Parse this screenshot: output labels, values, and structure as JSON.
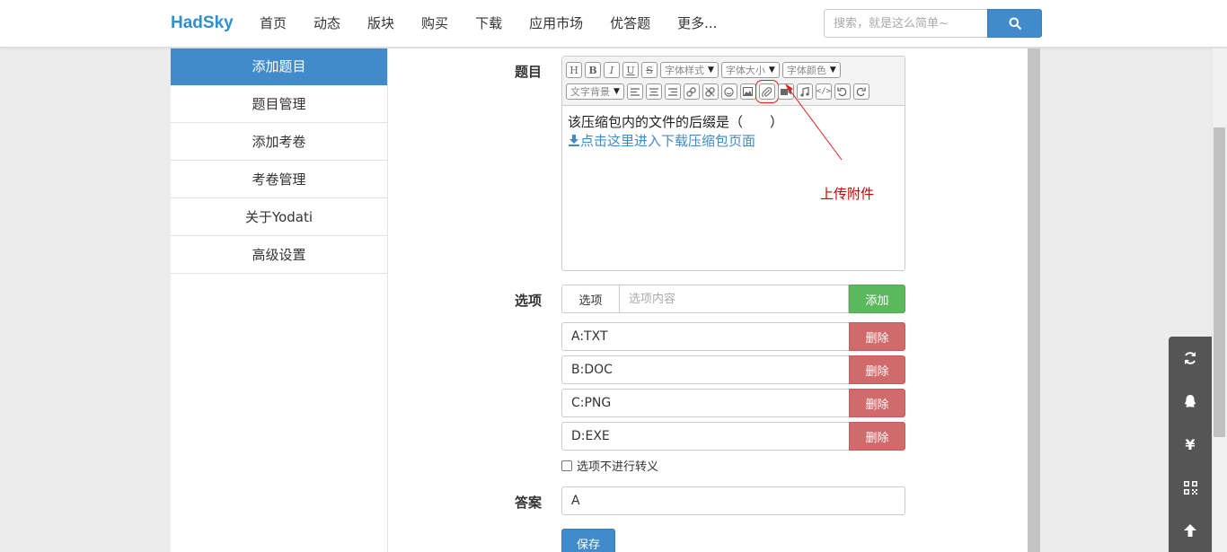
{
  "brand": "HadSky",
  "nav": [
    "首页",
    "动态",
    "版块",
    "购买",
    "下载",
    "应用市场",
    "优答题",
    "更多..."
  ],
  "search": {
    "placeholder": "搜索，就是这么简单~"
  },
  "sidebar": {
    "items": [
      {
        "label": "添加题目",
        "active": true
      },
      {
        "label": "题目管理"
      },
      {
        "label": "添加考卷"
      },
      {
        "label": "考卷管理"
      },
      {
        "label": "关于Yodati"
      },
      {
        "label": "高级设置"
      }
    ]
  },
  "form": {
    "question_label": "题目",
    "options_label": "选项",
    "answer_label": "答案",
    "toolbar": {
      "selects": [
        "字体样式",
        "字体大小",
        "字体颜色",
        "文字背景"
      ]
    },
    "question_text": "该压缩包内的文件的后缀是（　　）",
    "question_link": "点击这里进入下载压缩包页面",
    "annotation": "上传附件",
    "option_key": "选项",
    "option_value_placeholder": "选项内容",
    "add_label": "添加",
    "options": [
      "A:TXT",
      "B:DOC",
      "C:PNG",
      "D:EXE"
    ],
    "delete_label": "删除",
    "no_escape_label": "选项不进行转义",
    "answer_value": "A",
    "save_label": "保存"
  },
  "colors": {
    "primary": "#428bca",
    "success": "#5cb85c",
    "danger": "#d16a6a",
    "annotation": "#cc0000"
  }
}
